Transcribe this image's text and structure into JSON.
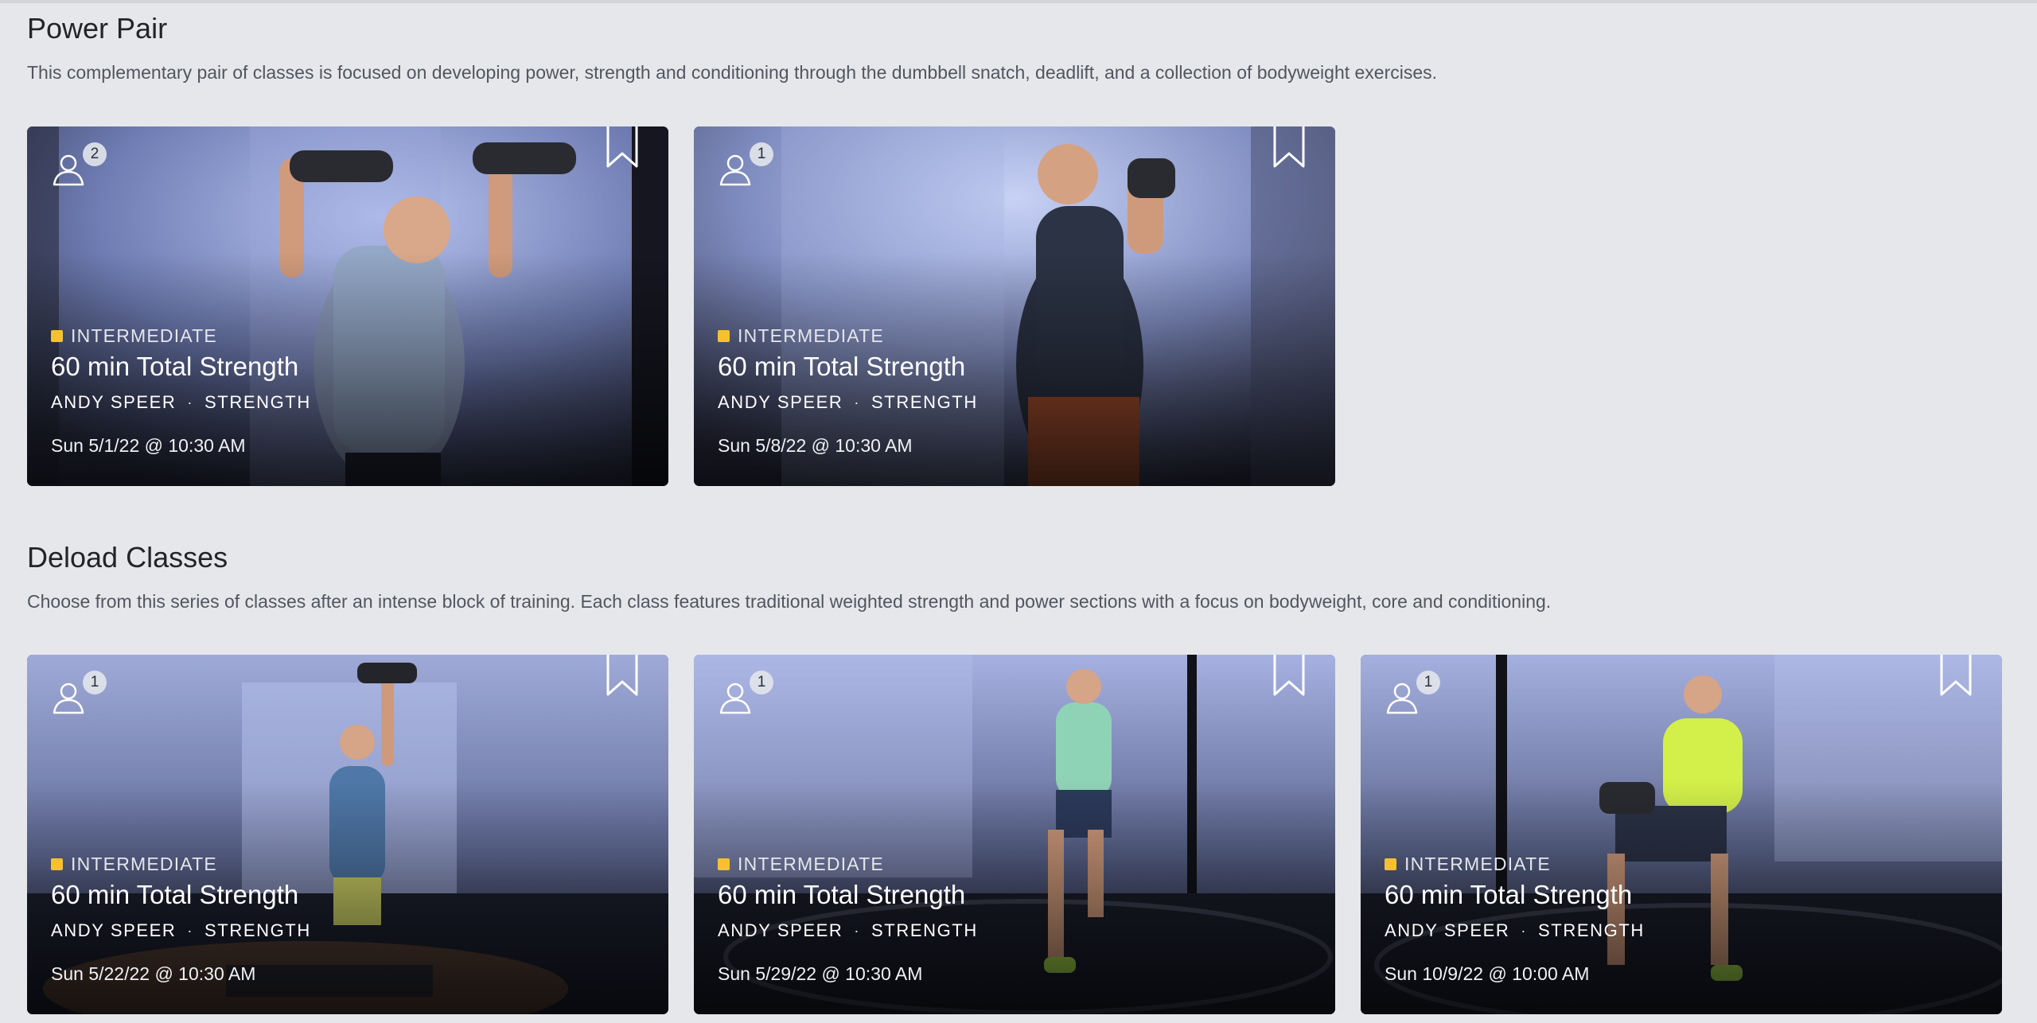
{
  "sections": [
    {
      "title": "Power Pair",
      "description": "This complementary pair of classes is focused on developing power, strength and conditioning through the dumbbell snatch, deadlift, and a collection of bodyweight exercises.",
      "cards": [
        {
          "count": "2",
          "level": "INTERMEDIATE",
          "title": "60 min Total Strength",
          "instructor": "ANDY SPEER",
          "dot": "·",
          "category": "STRENGTH",
          "datetime": "Sun 5/1/22 @ 10:30 AM"
        },
        {
          "count": "1",
          "level": "INTERMEDIATE",
          "title": "60 min Total Strength",
          "instructor": "ANDY SPEER",
          "dot": "·",
          "category": "STRENGTH",
          "datetime": "Sun 5/8/22 @ 10:30 AM"
        }
      ]
    },
    {
      "title": "Deload Classes",
      "description": "Choose from this series of classes after an intense block of training. Each class features traditional weighted strength and power sections with a focus on bodyweight, core and conditioning.",
      "cards": [
        {
          "count": "1",
          "level": "INTERMEDIATE",
          "title": "60 min Total Strength",
          "instructor": "ANDY SPEER",
          "dot": "·",
          "category": "STRENGTH",
          "datetime": "Sun 5/22/22 @ 10:30 AM"
        },
        {
          "count": "1",
          "level": "INTERMEDIATE",
          "title": "60 min Total Strength",
          "instructor": "ANDY SPEER",
          "dot": "·",
          "category": "STRENGTH",
          "datetime": "Sun 5/29/22 @ 10:30 AM"
        },
        {
          "count": "1",
          "level": "INTERMEDIATE",
          "title": "60 min Total Strength",
          "instructor": "ANDY SPEER",
          "dot": "·",
          "category": "STRENGTH",
          "datetime": "Sun 10/9/22 @ 10:00 AM"
        }
      ]
    }
  ],
  "colors": {
    "page_background": "#e6e7ea",
    "level_indicator": "#f5c12e",
    "card_overlay": "#3f4358"
  },
  "icons": {
    "participants": "person-outline-icon",
    "save": "bookmark-icon"
  }
}
